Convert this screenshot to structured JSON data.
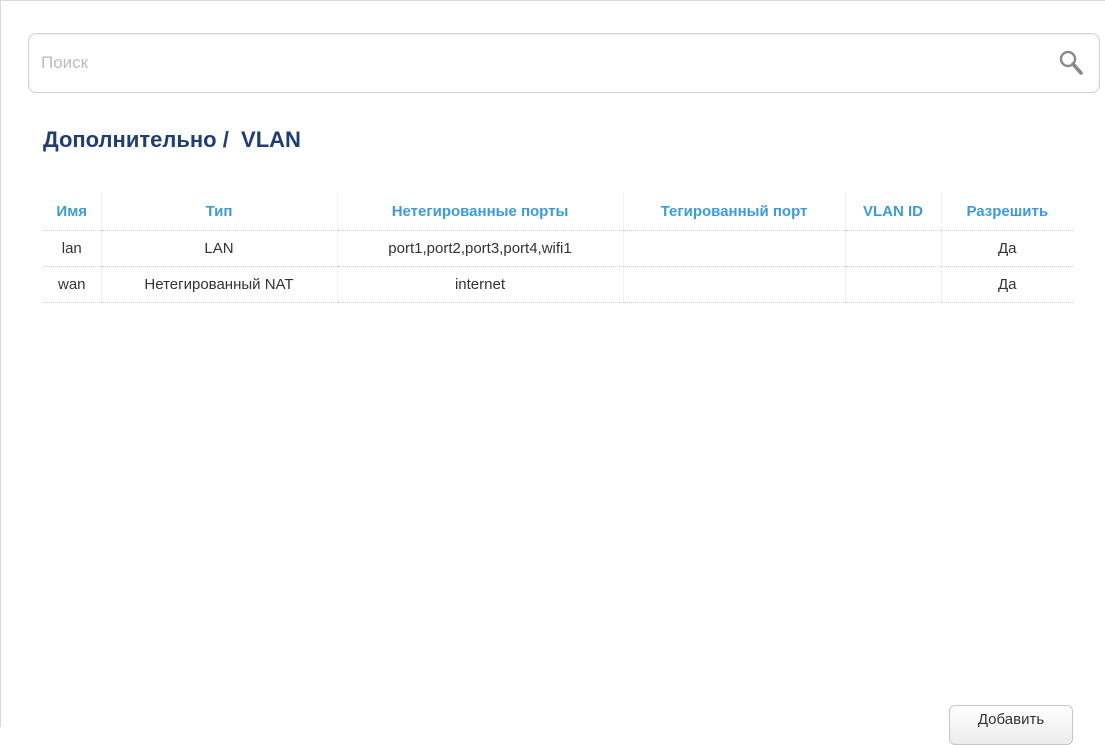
{
  "search": {
    "placeholder": "Поиск",
    "value": ""
  },
  "breadcrumb": {
    "text": "Дополнительно /  VLAN"
  },
  "table": {
    "headers": [
      "Имя",
      "Тип",
      "Нетегированные порты",
      "Тегированный порт",
      "VLAN ID",
      "Разрешить"
    ],
    "rows": [
      [
        "lan",
        "LAN",
        "port1,port2,port3,port4,wifi1",
        "",
        "",
        "Да"
      ],
      [
        "wan",
        "Нетегированный NAT",
        "internet",
        "",
        "",
        "Да"
      ]
    ]
  },
  "buttons": {
    "add_label": "Добавить"
  },
  "colors": {
    "title": "#1f3f73",
    "header": "#3c9be0",
    "text": "#333333"
  }
}
